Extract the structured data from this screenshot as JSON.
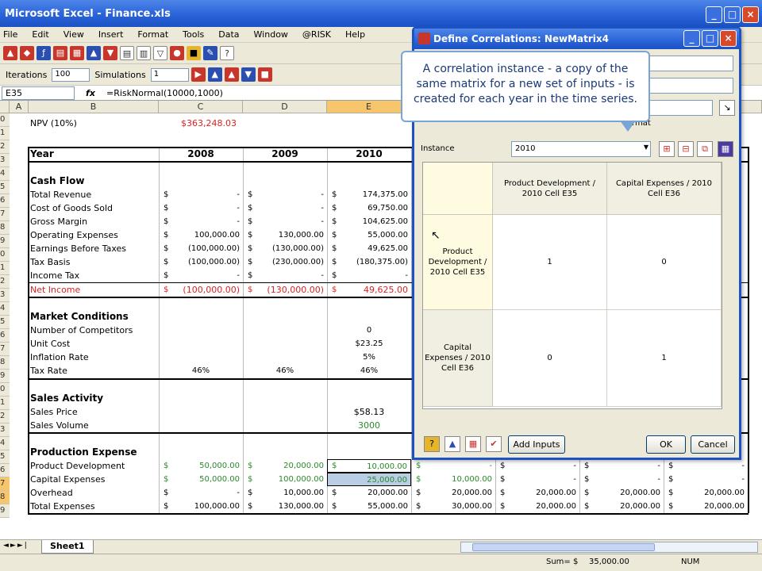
{
  "window": {
    "title": "Microsoft Excel - Finance.xls"
  },
  "menu": [
    "File",
    "Edit",
    "View",
    "Insert",
    "Format",
    "Tools",
    "Data",
    "Window",
    "@RISK",
    "Help"
  ],
  "toolbar2": {
    "iterations_label": "Iterations",
    "iterations_value": "100",
    "simulations_label": "Simulations",
    "simulations_value": "1"
  },
  "formula_bar": {
    "name_box": "E35",
    "fx": "fx",
    "formula": "=RiskNormal(10000,1000)"
  },
  "columns": [
    "A",
    "B",
    "C",
    "D",
    "E"
  ],
  "rows": {
    "npv_label": "NPV (10%)",
    "npv_value": "$363,248.03",
    "year_label": "Year",
    "years": [
      "2008",
      "2009",
      "2010"
    ],
    "cash_flow": "Cash Flow",
    "market_conditions": "Market Conditions",
    "sales_activity": "Sales Activity",
    "production_expense": "Production Expense",
    "currency": "$"
  },
  "cash_rows": [
    {
      "label": "Total Revenue",
      "c": "-",
      "d": "-",
      "e": "174,375.00"
    },
    {
      "label": "Cost of Goods Sold",
      "c": "-",
      "d": "-",
      "e": "69,750.00"
    },
    {
      "label": "Gross Margin",
      "c": "-",
      "d": "-",
      "e": "104,625.00"
    },
    {
      "label": "Operating Expenses",
      "c": "100,000.00",
      "d": "130,000.00",
      "e": "55,000.00"
    },
    {
      "label": "Earnings Before Taxes",
      "c": "(100,000.00)",
      "d": "(130,000.00)",
      "e": "49,625.00"
    },
    {
      "label": "Tax Basis",
      "c": "(100,000.00)",
      "d": "(230,000.00)",
      "e": "(180,375.00)"
    },
    {
      "label": "Income Tax",
      "c": "-",
      "d": "-",
      "e": "-"
    }
  ],
  "net_income": {
    "label": "Net Income",
    "c": "(100,000.00)",
    "d": "(130,000.00)",
    "e": "49,625.00"
  },
  "market_rows": [
    {
      "label": "Number of Competitors",
      "c": "",
      "d": "",
      "e": "0"
    },
    {
      "label": "Unit Cost",
      "c": "",
      "d": "",
      "e": "$23.25"
    },
    {
      "label": "Inflation Rate",
      "c": "",
      "d": "",
      "e": "5%"
    },
    {
      "label": "Tax Rate",
      "c": "46%",
      "d": "46%",
      "e": "46%"
    }
  ],
  "sales_rows": [
    {
      "label": "Sales Price",
      "e": "$58.13"
    },
    {
      "label": "Sales Volume",
      "e": "3000"
    }
  ],
  "prod_rows": [
    {
      "label": "Product Development",
      "c": "50,000.00",
      "d": "20,000.00",
      "e": "10,000.00",
      "f": "-",
      "g": "-",
      "h": "-",
      "i": "-"
    },
    {
      "label": "Capital Expenses",
      "c": "50,000.00",
      "d": "100,000.00",
      "e": "25,000.00",
      "f": "10,000.00",
      "g": "-",
      "h": "-",
      "i": "-"
    },
    {
      "label": "Overhead",
      "c": "-",
      "d": "10,000.00",
      "e": "20,000.00",
      "f": "20,000.00",
      "g": "20,000.00",
      "h": "20,000.00",
      "i": "20,000.00"
    },
    {
      "label": "Total Expenses",
      "c": "100,000.00",
      "d": "130,000.00",
      "e": "55,000.00",
      "f": "30,000.00",
      "g": "20,000.00",
      "h": "20,000.00",
      "i": "20,000.00"
    }
  ],
  "row_numbers": [
    "0",
    "1",
    "2",
    "3",
    "4",
    "5",
    "6",
    "7",
    "8",
    "9",
    "0",
    "1",
    "2",
    "3",
    "4",
    "5",
    "6",
    "7",
    "8",
    "9",
    "0",
    "1",
    "2",
    "3",
    "4",
    "5",
    "6",
    "7",
    "8",
    "9"
  ],
  "sheet_tab": "Sheet1",
  "status": {
    "sum": "Sum= $",
    "sum_value": "35,000.00",
    "num": "NUM"
  },
  "dialog": {
    "title": "Define Correlations: NewMatrix4",
    "callout": "A correlation instance - a copy of the same matrix for a new set of inputs - is created for each year in the time series.",
    "format_label": "ormat",
    "instance_label": "Instance",
    "instance_value": "2010",
    "col_headers": [
      "Product Development / 2010 Cell E35",
      "Capital Expenses / 2010 Cell E36"
    ],
    "row_headers": [
      "Product Development / 2010 Cell E35",
      "Capital Expenses / 2010 Cell E36"
    ],
    "values": [
      [
        "1",
        "0"
      ],
      [
        "0",
        "1"
      ]
    ],
    "add_inputs": "Add Inputs",
    "ok": "OK",
    "cancel": "Cancel"
  },
  "colors": {
    "title_blue": "#2a63d8",
    "red_text": "#e02020",
    "green_text": "#2a8a2a",
    "selected_header": "#f7c56c"
  }
}
